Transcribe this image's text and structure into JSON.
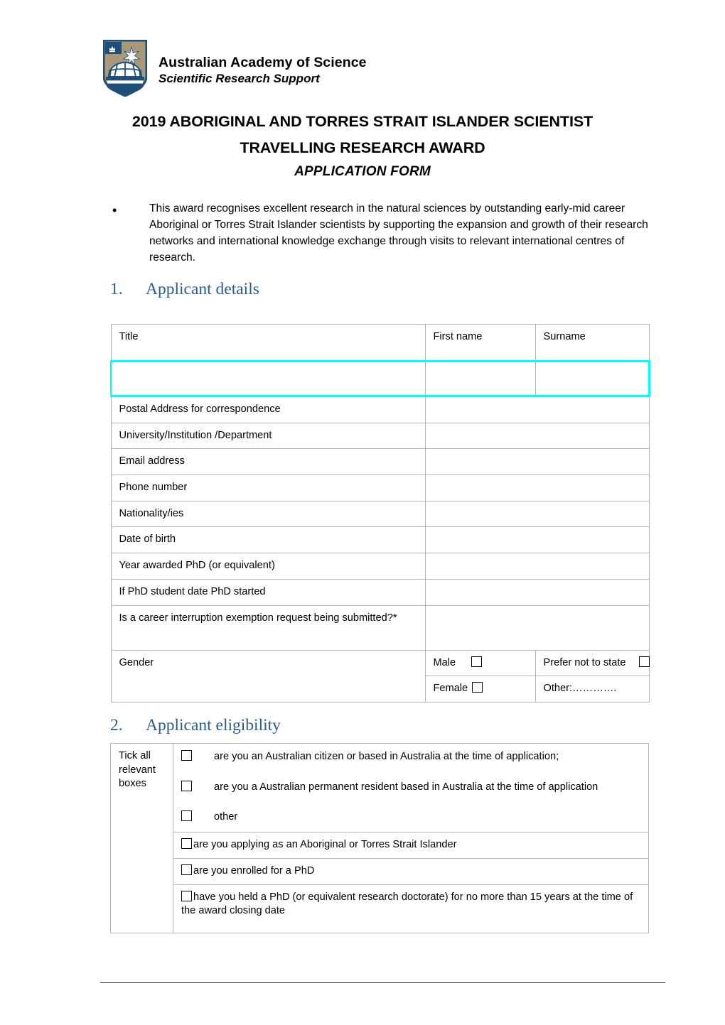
{
  "header": {
    "logo_name": "australian-academy-of-science-crest",
    "organisation": "Australian Academy of Science",
    "unit": "Scientific Research Support"
  },
  "title": {
    "line1": "2019 ABORIGINAL AND TORRES STRAIT ISLANDER SCIENTIST",
    "line2": "TRAVELLING RESEARCH AWARD",
    "line3": "APPLICATION FORM"
  },
  "intro": {
    "bullet": "•",
    "text": "This award recognises excellent research in the natural sciences by outstanding early-mid career Aboriginal or Torres Strait Islander scientists by supporting the expansion and growth of their research networks and international knowledge exchange through visits to relevant international centres of research."
  },
  "sections": {
    "applicant_details": {
      "number": "1.",
      "label": "Applicant details"
    },
    "applicant_eligibility": {
      "number": "2.",
      "label": "Applicant eligibility"
    }
  },
  "applicant_details_table": {
    "name_headers": {
      "title": "Title",
      "first_name": "First name",
      "surname": "Surname"
    },
    "name_values": {
      "title": "",
      "first_name": "",
      "surname": ""
    },
    "rows": [
      {
        "label": "Postal Address for correspondence",
        "value": ""
      },
      {
        "label": "University/Institution /Department",
        "value": ""
      },
      {
        "label": "Email address",
        "value": ""
      },
      {
        "label": "Phone number",
        "value": ""
      },
      {
        "label": "Nationality/ies",
        "value": ""
      },
      {
        "label": "Date of birth",
        "value": ""
      },
      {
        "label": "Year awarded PhD (or equivalent)",
        "value": ""
      },
      {
        "label": "If PhD student date PhD started",
        "value": ""
      },
      {
        "label": "Is a career interruption exemption request being submitted?*",
        "value": ""
      }
    ],
    "gender": {
      "label": "Gender",
      "male": "Male",
      "female": "Female",
      "prefer_not": "Prefer not to state",
      "other": "Other:…………."
    }
  },
  "eligibility_table": {
    "instruction": "Tick all relevant boxes",
    "checkbox_items": [
      "are you an Australian citizen or based in Australia at the time of application;",
      "are you a Australian permanent resident based in Australia at the time of application",
      "other"
    ],
    "statement_rows": [
      "are you applying as an Aboriginal or Torres Strait Islander",
      "are you enrolled for a PhD",
      "have you held a PhD (or equivalent research doctorate) for no more than 15 years at the time of the award closing date"
    ]
  },
  "colors": {
    "heading_blue": "#2E5C8A",
    "accent_cyan": "#00FFFF",
    "crest_tan": "#A89A78",
    "crest_blue": "#1F4E79",
    "table_border": "#B6B6B6"
  }
}
